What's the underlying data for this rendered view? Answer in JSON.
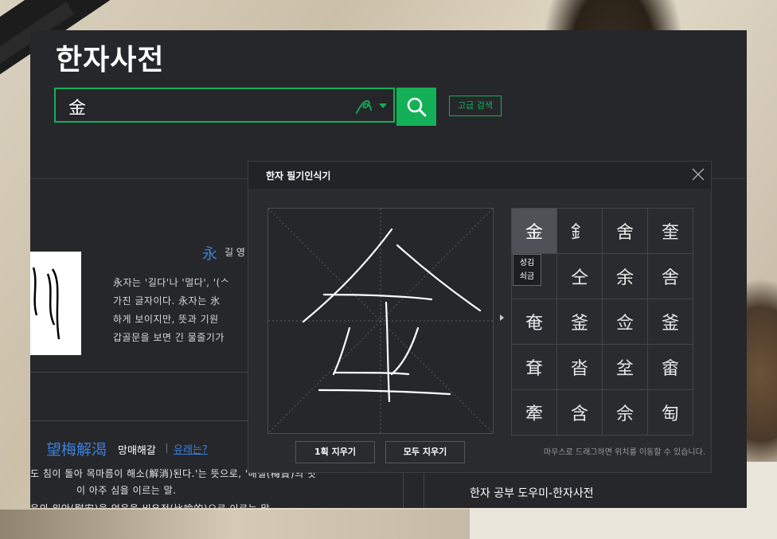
{
  "app": {
    "title": "한자사전"
  },
  "search": {
    "value": "金",
    "advanced_label": "고급 검색"
  },
  "entry": {
    "hanja": "永",
    "meaning": "길 영",
    "lines": [
      "永자는 '길다'나 '멀다', '(ᄉ",
      "가진 글자이다. 永자는 氷",
      "하게 보이지만, 뜻과 기원",
      "갑골문을 보면 긴 물줄기가"
    ]
  },
  "idiom": {
    "hanja": "望梅解渴",
    "reading": "망매해갈",
    "origin_link": "유래는?",
    "lines": [
      "도 침이 돌아 목마름이 해소(解消)된다.'는 뜻으로, '매실(梅實)의 맛",
      "이 아주 심을 이르는 말.",
      "음의 위안(慰安)을 얻음을 비유적(比喩的)으로 이르는 말"
    ]
  },
  "helper": {
    "title": "한자 공부 도우미-한자사전"
  },
  "handwriting": {
    "title": "한자 필기인식기",
    "undo_label": "1획 지우기",
    "clear_label": "모두 지우기",
    "hint": "마우스로 드래그하면 위치를 이동할 수 있습니다.",
    "tooltip": [
      "성김",
      "쇠금"
    ],
    "candidates": [
      "金",
      "釒",
      "舍",
      "奎",
      "",
      "仝",
      "余",
      "舎",
      "奄",
      "釜",
      "佥",
      "釜",
      "耷",
      "沓",
      "坌",
      "畬",
      "牽",
      "含",
      "佘",
      "匋"
    ],
    "selected_index": 0
  },
  "colors": {
    "accent": "#14b058",
    "link": "#3d7fd8",
    "panel": "#26272b"
  },
  "icons": [
    "hand-writing-icon",
    "chevron-down-icon",
    "search-icon",
    "close-icon",
    "chevron-right-icon"
  ]
}
